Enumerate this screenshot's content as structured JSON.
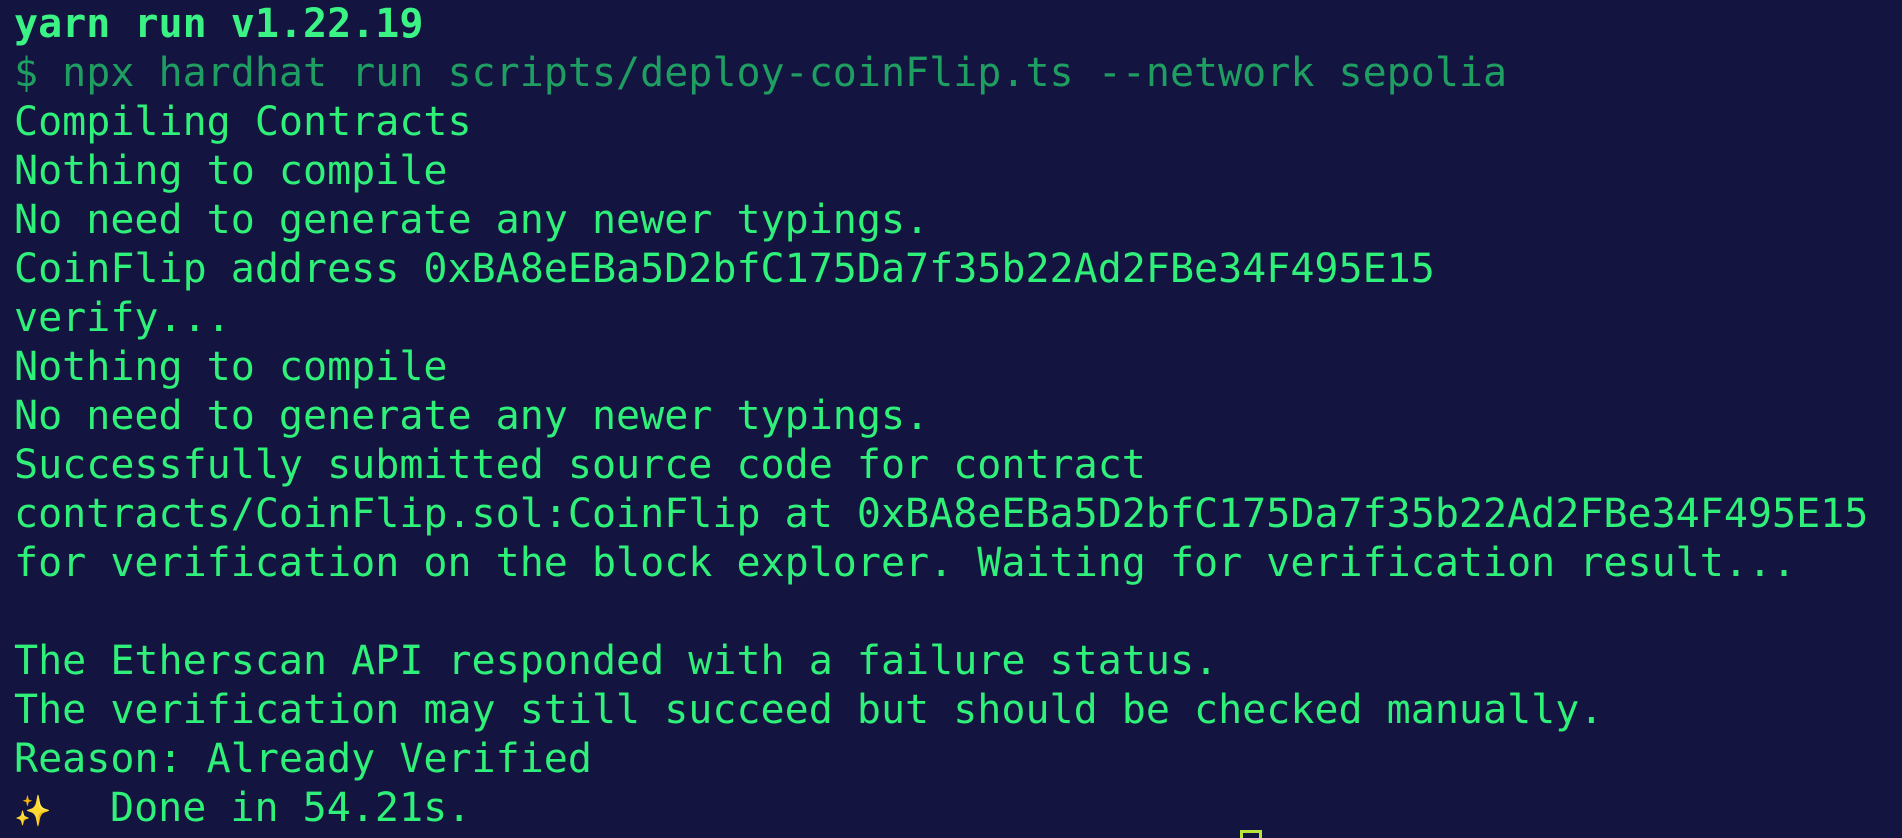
{
  "terminal": {
    "lines": [
      "yarn run v1.22.19",
      "$ npx hardhat run scripts/deploy-coinFlip.ts --network sepolia",
      "Compiling Contracts",
      "Nothing to compile",
      "No need to generate any newer typings.",
      "CoinFlip address 0xBA8eEBa5D2bfC175Da7f35b22Ad2FBe34F495E15",
      "verify...",
      "Nothing to compile",
      "No need to generate any newer typings.",
      "Successfully submitted source code for contract",
      "contracts/CoinFlip.sol:CoinFlip at 0xBA8eEBa5D2bfC175Da7f35b22Ad2FBe34F495E15",
      "for verification on the block explorer. Waiting for verification result...",
      "",
      "The Etherscan API responded with a failure status.",
      "The verification may still succeed but should be checked manually.",
      "Reason: Already Verified"
    ],
    "done_icon": "sparkles-icon",
    "done_glyph": "✨",
    "done_text": "Done in 54.21s."
  },
  "colors": {
    "background": "#141441",
    "text": "#2ff078",
    "command": "#1f9e62",
    "cursor": "#b9e43a"
  }
}
